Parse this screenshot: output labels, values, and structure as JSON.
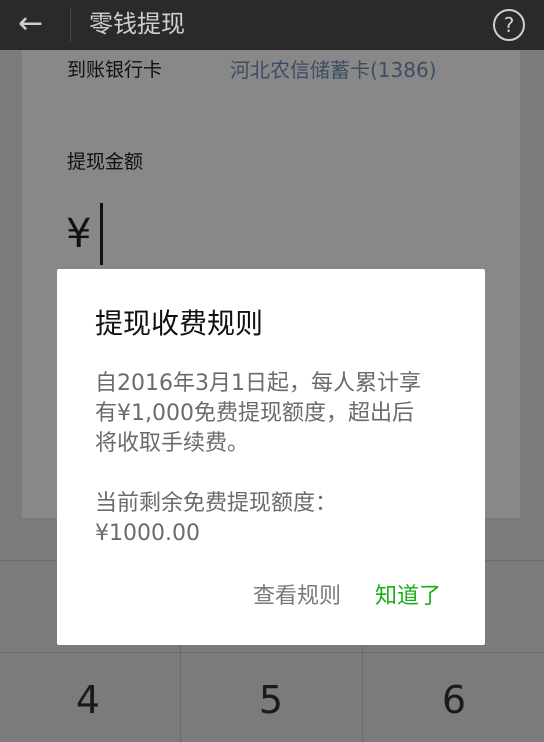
{
  "header": {
    "back_icon": "arrow-left-icon",
    "title": "零钱提现",
    "help_icon": "question-circle-icon",
    "help_symbol": "?"
  },
  "form": {
    "bank_label": "到账银行卡",
    "bank_value": "河北农信储蓄卡(1386)",
    "amount_label": "提现金额",
    "currency_symbol": "¥"
  },
  "keypad": {
    "visible_keys": [
      "4",
      "5",
      "6"
    ]
  },
  "dialog": {
    "title": "提现收费规则",
    "body_line1": "自2016年3月1日起，每人累计享",
    "body_line2": "有¥1,000免费提现额度，超出后",
    "body_line3": "将收取手续费。",
    "remaining_label": "当前剩余免费提现额度：",
    "remaining_value": "¥1000.00",
    "view_rules_label": "查看规则",
    "ok_label": "知道了"
  },
  "colors": {
    "accent_green": "#1aad19",
    "topbar": "#2a2a2a",
    "overlay_dim": "#7b7b7b"
  }
}
